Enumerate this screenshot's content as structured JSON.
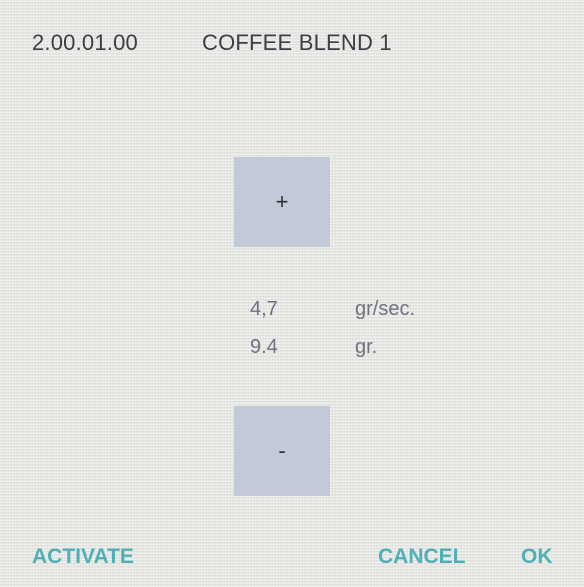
{
  "header": {
    "code": "2.00.01.00",
    "title": "COFFEE BLEND 1"
  },
  "stepper": {
    "plus_label": "+",
    "minus_label": "-"
  },
  "readouts": {
    "flow_value": "4,7",
    "flow_unit": "gr/sec.",
    "weight_value": "9.4",
    "weight_unit": "gr."
  },
  "softkeys": {
    "activate": "ACTIVATE",
    "cancel": "CANCEL",
    "ok": "OK"
  },
  "colors": {
    "background": "#e8e8e4",
    "button": "#c2cad8",
    "accent": "#4fb0b8",
    "text": "#3b3f45",
    "readout_text": "#6d7280"
  }
}
